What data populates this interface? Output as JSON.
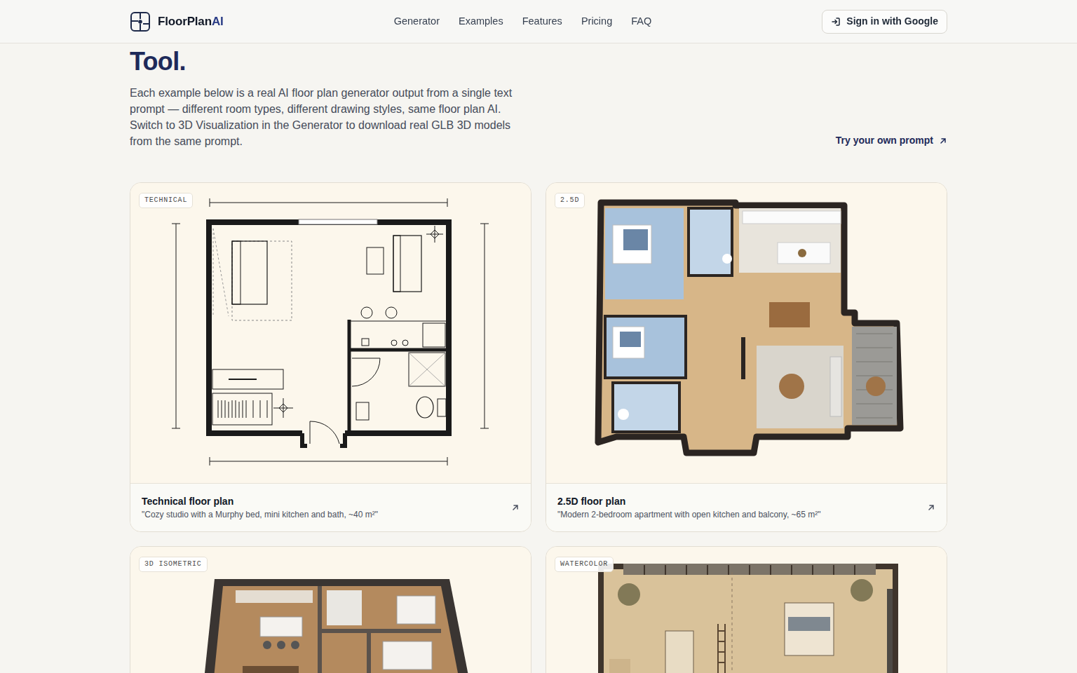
{
  "brand": {
    "name": "FloorPlan",
    "suffix": "AI"
  },
  "nav": [
    "Generator",
    "Examples",
    "Features",
    "Pricing",
    "FAQ"
  ],
  "sign_in": "Sign in with Google",
  "hero": {
    "heading": "Tool.",
    "intro": "Each example below is a real AI floor plan generator output from a single text prompt — different room types, different drawing styles, same floor plan AI. Switch to 3D Visualization in the Generator to download real GLB 3D models from the same prompt.",
    "cta": "Try your own prompt"
  },
  "examples": [
    {
      "badge": "TECHNICAL",
      "kind": "technical",
      "title": "Technical floor plan",
      "prompt": "\"Cozy studio with a Murphy bed, mini kitchen and bath, ~40 m²\""
    },
    {
      "badge": "2.5D",
      "kind": "render",
      "title": "2.5D floor plan",
      "prompt": "\"Modern 2-bedroom apartment with open kitchen and balcony, ~65 m²\""
    },
    {
      "badge": "3D ISOMETRIC",
      "kind": "isometric"
    },
    {
      "badge": "WATERCOLOR",
      "kind": "watercolor"
    }
  ]
}
